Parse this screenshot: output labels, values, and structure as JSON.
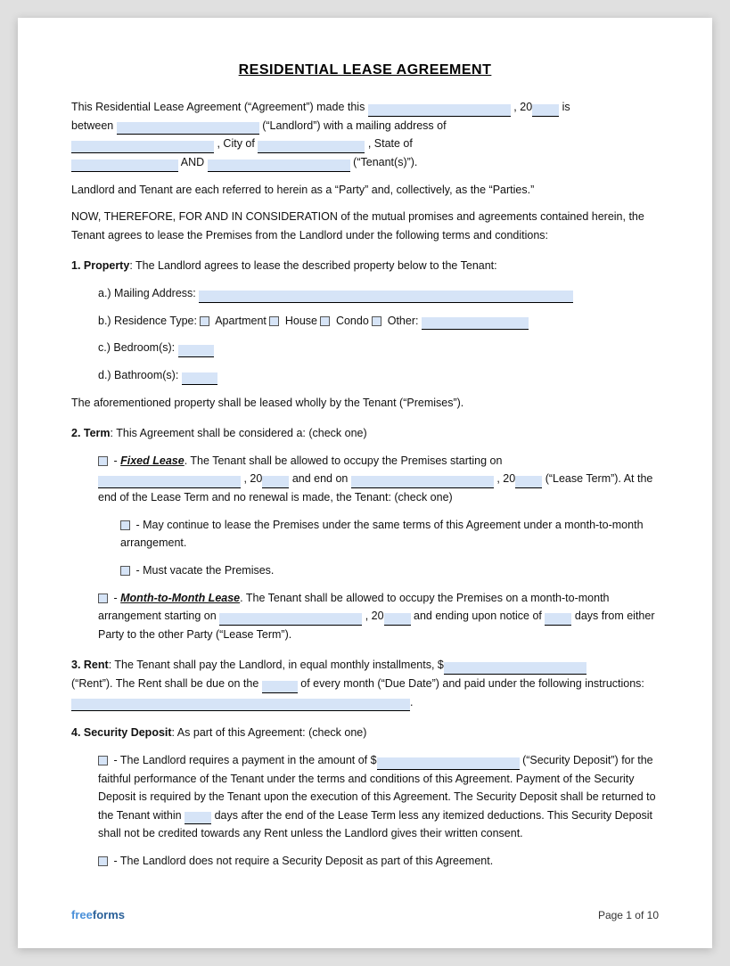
{
  "title": "RESIDENTIAL LEASE AGREEMENT",
  "intro": {
    "line1a": "This Residential Lease Agreement (“Agreement”) made this",
    "line1b": ", 20",
    "line1c": "is",
    "line2a": "between",
    "line2b": "(“Landlord”) with a mailing address of",
    "line3a": ", City of",
    "line3b": ", State of",
    "line4a": "AND",
    "line4b": "(“Tenant(s)”)."
  },
  "parties_line": "Landlord and Tenant are each referred to herein as a “Party” and, collectively, as the “Parties.”",
  "consideration": "NOW, THEREFORE, FOR AND IN CONSIDERATION of the mutual promises and agreements contained herein, the Tenant agrees to lease the Premises from the Landlord under the following terms and conditions:",
  "section1": {
    "heading": "1. Property",
    "text": ": The Landlord agrees to lease the described property below to the Tenant:",
    "a_label": "a.)  Mailing Address:",
    "b_label": "b.)  Residence Type:",
    "b_options": [
      "Apartment",
      "House",
      "Condo",
      "Other:"
    ],
    "c_label": "c.)  Bedroom(s):",
    "d_label": "d.)  Bathroom(s):",
    "footer_text": "The aforementioned property shall be leased wholly by the Tenant (“Premises”)."
  },
  "section2": {
    "heading": "2. Term",
    "text": ": This Agreement shall be considered a: (check one)",
    "fixed_label": "- ",
    "fixed_italic": "Fixed Lease",
    "fixed_text": ". The Tenant shall be allowed to occupy the Premises starting on",
    "fixed_field1": "",
    "fixed_20a": ", 20",
    "fixed_and": "and end on",
    "fixed_field2": "",
    "fixed_20b": ", 20",
    "fixed_lease_term": "(“Lease Term”). At the end of the Lease Term and no renewal is made, the Tenant: (check one)",
    "option1": "- May continue to lease the Premises under the same terms of this Agreement under a month-to-month arrangement.",
    "option2": "- Must vacate the Premises.",
    "month_label": "- ",
    "month_italic": "Month-to-Month Lease",
    "month_text": ". The Tenant shall be allowed to occupy the Premises on a month-to-month arrangement starting on",
    "month_field": "",
    "month_20": ", 20",
    "month_ending": "and ending upon notice of",
    "month_days": "days from either Party to the other Party (“Lease Term”)."
  },
  "section3": {
    "heading": "3. Rent",
    "text": ": The Tenant shall pay the Landlord, in equal monthly installments, $",
    "rent_text2": "(“Rent”). The Rent shall be due on the",
    "rent_text3": "of every month (“Due Date”) and paid under the following instructions:",
    "rent_text4": "."
  },
  "section4": {
    "heading": "4. Security Deposit",
    "text": ": As part of this Agreement: (check one)",
    "option1_text": "- The Landlord requires a payment in the amount of $",
    "option1_text2": "(“Security Deposit”) for the faithful performance of the Tenant under the terms and conditions of this Agreement. Payment of the Security Deposit is required by the Tenant upon the execution of this Agreement. The Security Deposit shall be returned to the Tenant within",
    "option1_days": "days after the end of the Lease Term less any itemized deductions. This Security Deposit shall not be credited towards any Rent unless the Landlord gives their written consent.",
    "option2_text": "- The Landlord does not require a Security Deposit as part of this Agreement."
  },
  "footer": {
    "brand_free": "free",
    "brand_forms": "forms",
    "page": "Page 1 of 10"
  }
}
